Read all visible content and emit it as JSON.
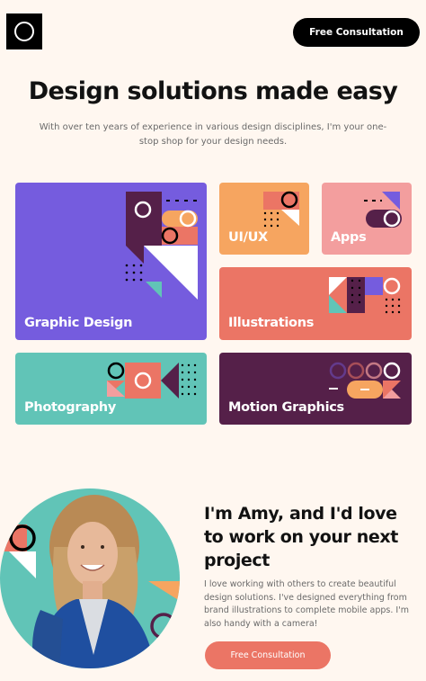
{
  "header": {
    "logo_icon": "circle-logo-icon",
    "cta_label": "Free Consultation"
  },
  "hero": {
    "title": "Design solutions made easy",
    "description": "With over ten years of experience in various design disciplines, I'm your one-stop shop for your design needs."
  },
  "services": [
    {
      "label": "Graphic Design",
      "color": "#755CDE"
    },
    {
      "label": "UI/UX",
      "color": "#F6A560"
    },
    {
      "label": "Apps",
      "color": "#F39E9E"
    },
    {
      "label": "Illustrations",
      "color": "#EB7565"
    },
    {
      "label": "Photography",
      "color": "#61C4B7"
    },
    {
      "label": "Motion Graphics",
      "color": "#552049"
    }
  ],
  "about": {
    "title": "I'm Amy, and I'd love to work on your next project",
    "description": "I love working with others to create beautiful design solutions. I've designed everything from brand illustrations to complete mobile apps. I'm also handy with a camera!",
    "cta_label": "Free Consultation"
  },
  "colors": {
    "background": "#FFF7F0",
    "black": "#000000",
    "purple": "#755CDE",
    "orange": "#F6A560",
    "pink": "#F39E9E",
    "red": "#EB7565",
    "teal": "#61C4B7",
    "dark_purple": "#552049"
  }
}
